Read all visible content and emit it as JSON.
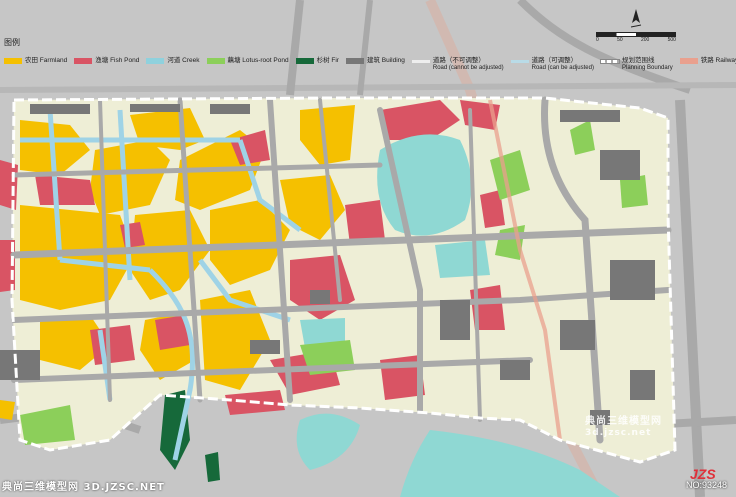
{
  "legend_title": "图例",
  "legend": [
    {
      "label": "农田  Farmland",
      "color": "#f5c000"
    },
    {
      "label": "渔塘  Fish Pond",
      "color": "#d95464"
    },
    {
      "label": "河道  Creek",
      "color": "#8fd1dd"
    },
    {
      "label": "藕塘  Lotus-root Pond",
      "color": "#8ccf5a"
    },
    {
      "label": "杉树  Fir",
      "color": "#16693a"
    },
    {
      "label": "建筑  Building",
      "color": "#777777"
    },
    {
      "label": "道路（不可调整）",
      "sub": "Road (cannot be adjusted)",
      "color": "#eeeeee"
    },
    {
      "label": "道路（可调整）",
      "sub": "Road (can be adjusted)",
      "color": "#b9dbe7"
    },
    {
      "label": "规划范围线",
      "sub": "Planning Boundary",
      "color": "#ffffff"
    },
    {
      "label": "铁路  Railway",
      "color": "#e9a08e"
    }
  ],
  "scale_labels": [
    "0",
    "50",
    "200",
    "500"
  ],
  "watermarks": {
    "bottom": "典尚三维模型网 3D.JZSC.NET",
    "right_cn": "典尚三维模型网",
    "right_en": "3d.jzsc.net",
    "id": "NO:93248",
    "logo": "JZS"
  },
  "colors": {
    "background": "#c6c6c6",
    "land": "#eeeed6",
    "road": "#a9a9a9",
    "lake": "#8fd8d3",
    "farmland": "#f5c000",
    "fish_pond": "#d95464",
    "creek": "#9fd3e6",
    "lotus": "#8ccf5a",
    "fir": "#16693a",
    "building": "#777777",
    "railway": "#e9a08e"
  }
}
